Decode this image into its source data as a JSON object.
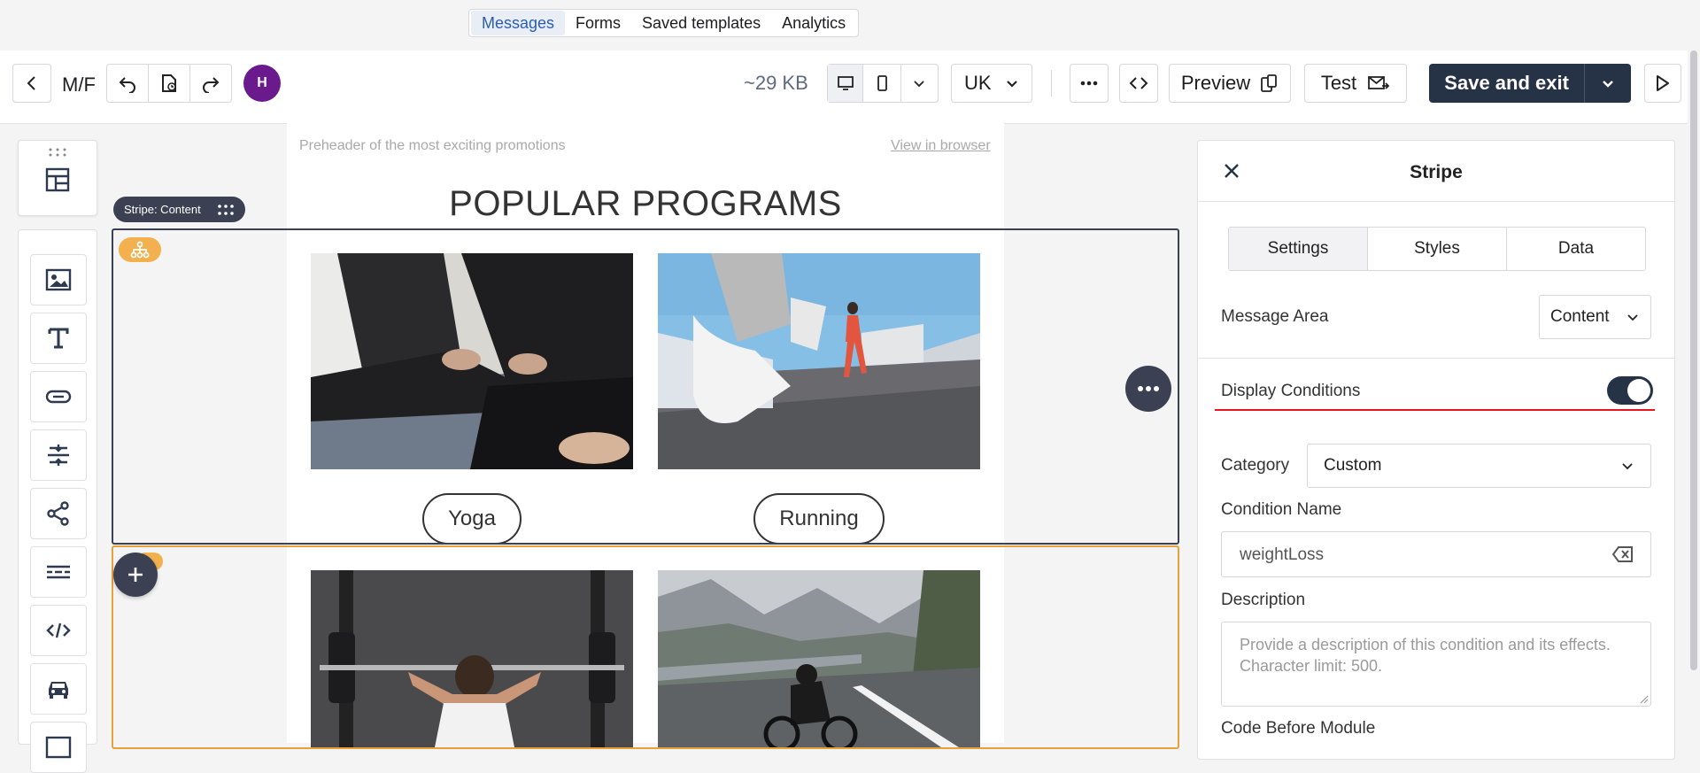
{
  "nav": {
    "tabs": [
      {
        "label": "Messages",
        "active": true
      },
      {
        "label": "Forms"
      },
      {
        "label": "Saved templates"
      },
      {
        "label": "Analytics"
      }
    ]
  },
  "toolbar": {
    "title": "M/F",
    "avatar_initial": "H",
    "size": "~29 KB",
    "language": "UK",
    "preview_label": "Preview",
    "test_label": "Test",
    "save_label": "Save and exit",
    "accent": "#263246"
  },
  "canvas": {
    "preheader": "Preheader of the most exciting promotions",
    "view_in_browser": "View in browser",
    "headline": "POPULAR PROGRAMS",
    "stripe_label": "Stripe: Content",
    "programs": [
      {
        "label": "Yoga",
        "image": "yoga-photo"
      },
      {
        "label": "Running",
        "image": "running-photo"
      },
      {
        "label": "",
        "image": "weightlifting-photo"
      },
      {
        "label": "",
        "image": "cycling-photo"
      }
    ],
    "selection_color": "#3b4152",
    "condition_color": "#f2b04e"
  },
  "panel": {
    "title": "Stripe",
    "tabs": [
      {
        "label": "Settings",
        "active": true
      },
      {
        "label": "Styles"
      },
      {
        "label": "Data"
      }
    ],
    "message_area_label": "Message Area",
    "message_area_value": "Content",
    "display_conditions_label": "Display Conditions",
    "display_conditions_on": true,
    "category_label": "Category",
    "category_value": "Custom",
    "condition_name_label": "Condition Name",
    "condition_name_value": "weightLoss",
    "description_label": "Description",
    "description_placeholder": "Provide a description of this condition and its effects. Character limit: 500.",
    "code_before_label": "Code Before Module"
  }
}
